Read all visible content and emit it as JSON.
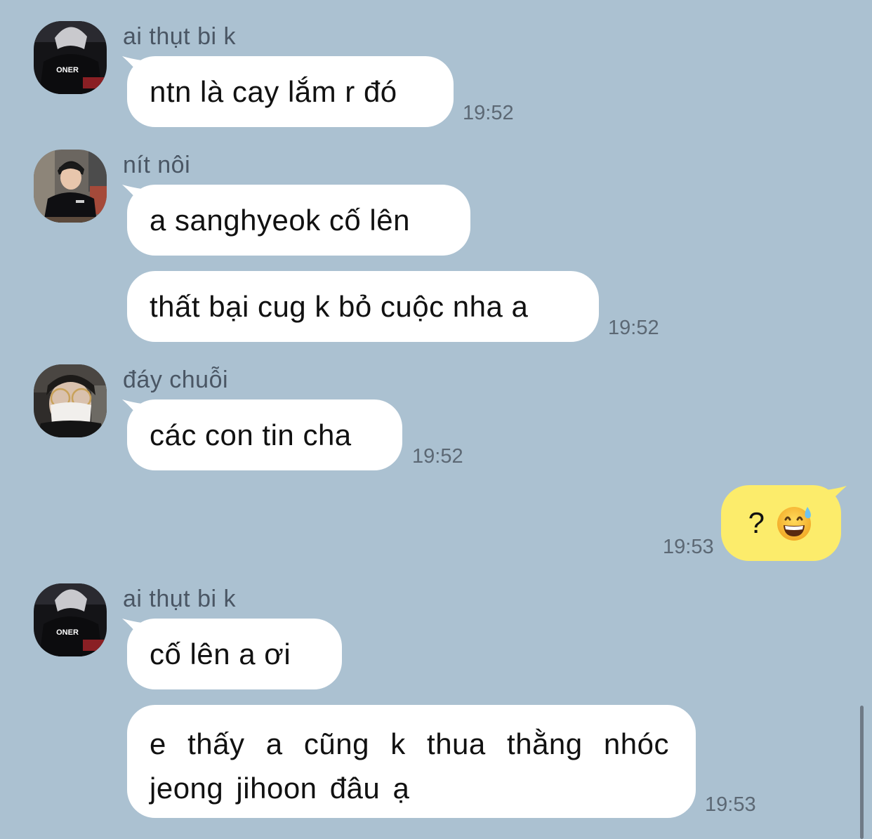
{
  "messages": [
    {
      "sender": "ai thụt bi k",
      "bubbles": [
        "ntn là cay lắm r đó"
      ],
      "time": "19:52"
    },
    {
      "sender": "nít nôi",
      "bubbles": [
        "a sanghyeok cố lên",
        "thất bại cug k bỏ cuộc nha a"
      ],
      "time": "19:52"
    },
    {
      "sender": "đáy chuỗi",
      "bubbles": [
        "các con tin cha"
      ],
      "time": "19:52"
    },
    {
      "sender": "me",
      "text": "?",
      "emoji": "grinning-face-with-sweat",
      "time": "19:53"
    },
    {
      "sender": "ai thụt bi k",
      "bubbles": [
        "cố lên a ơi",
        "e thấy a cũng k thua thằng nhóc jeong jihoon đâu ạ"
      ],
      "time": "19:53"
    }
  ],
  "jersey_text": "ONER",
  "colors": {
    "background": "#abc1d1",
    "incoming_bubble": "#ffffff",
    "outgoing_bubble": "#fcec6b",
    "timestamp": "#5c6874",
    "sender_name": "#4a5664"
  }
}
